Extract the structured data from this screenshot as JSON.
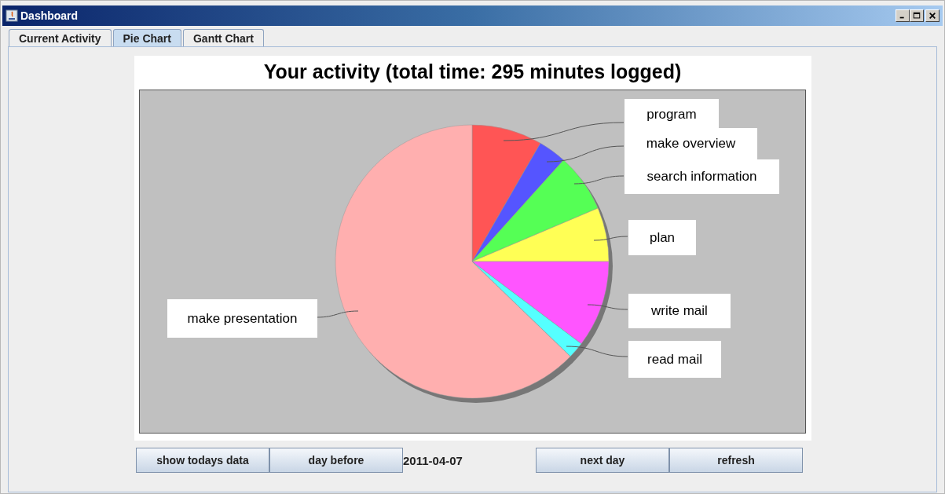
{
  "window": {
    "title": "Dashboard"
  },
  "tabs": [
    {
      "label": "Current Activity",
      "selected": false
    },
    {
      "label": "Pie Chart",
      "selected": true
    },
    {
      "label": "Gantt Chart",
      "selected": false
    }
  ],
  "chart": {
    "title": "Your activity (total time: 295 minutes logged)",
    "slices": [
      {
        "label": "program",
        "color": "#ff5555"
      },
      {
        "label": "make overview",
        "color": "#5555ff"
      },
      {
        "label": "search information",
        "color": "#55ff55"
      },
      {
        "label": "plan",
        "color": "#ffff55"
      },
      {
        "label": "make presentation",
        "color": "#ffafaf"
      },
      {
        "label": "write mail",
        "color": "#ff55ff"
      },
      {
        "label": "read mail",
        "color": "#55ffff"
      }
    ]
  },
  "left_buttons": [
    "show todays data",
    "day before"
  ],
  "date": "2011-04-07",
  "right_buttons": [
    "next day",
    "refresh"
  ]
}
